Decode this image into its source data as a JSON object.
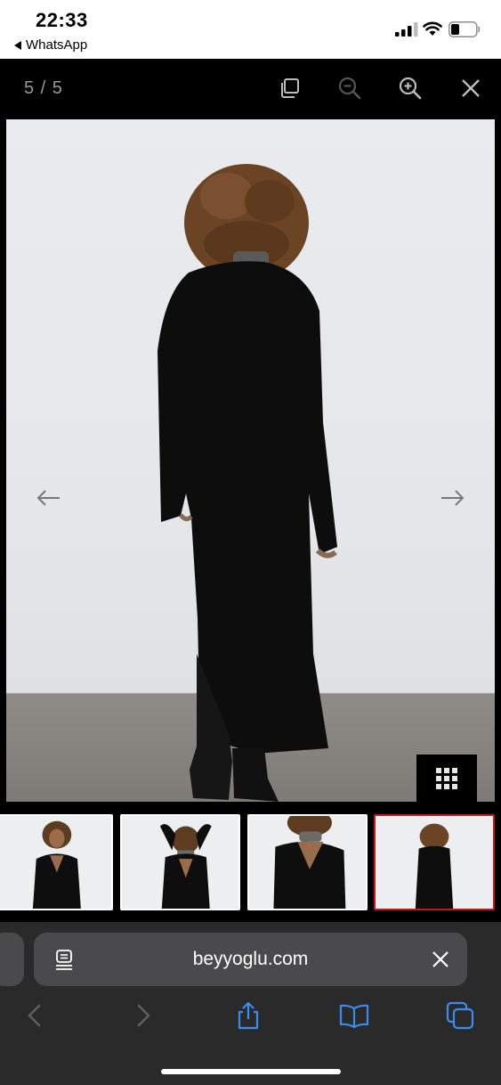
{
  "status_bar": {
    "time": "22:33",
    "back_app": "WhatsApp",
    "icons": [
      "signal-icon",
      "wifi-icon",
      "battery-icon"
    ]
  },
  "viewer": {
    "counter": "5 / 5",
    "header_icons": [
      "copy-icon",
      "zoom-out-icon",
      "zoom-in-icon",
      "close-icon"
    ],
    "nav_icons": [
      "arrow-left-icon",
      "arrow-right-icon"
    ],
    "grid_icon": "grid-icon",
    "thumbnails_count": 4,
    "active_thumbnail": 4
  },
  "browser": {
    "url": "beyyoglu.com",
    "toolbar_icons": [
      "back-icon",
      "forward-icon",
      "share-icon",
      "bookmarks-icon",
      "tabs-icon"
    ]
  },
  "colors": {
    "active_border": "#c4161c",
    "safari_blue": "#3b8cf0",
    "background": "#000000"
  }
}
